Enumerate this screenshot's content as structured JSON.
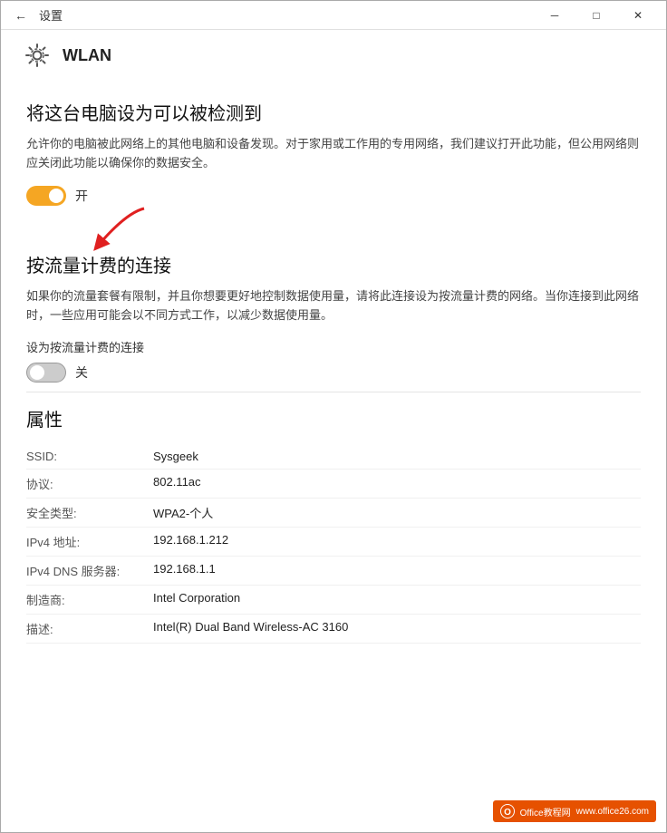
{
  "titlebar": {
    "back_label": "←",
    "title": "设置",
    "minimize_label": "─",
    "maximize_label": "□",
    "close_label": "✕"
  },
  "page_header": {
    "icon": "⚙",
    "title": "WLAN"
  },
  "section1": {
    "title": "将这台电脑设为可以被检测到",
    "desc": "允许你的电脑被此网络上的其他电脑和设备发现。对于家用或工作用的专用网络，我们建议打开此功能，但公用网络则应关闭此功能以确保你的数据安全。",
    "toggle_state": "on",
    "toggle_label": "开"
  },
  "section2": {
    "title": "按流量计费的连接",
    "desc": "如果你的流量套餐有限制，并且你想要更好地控制数据使用量，请将此连接设为按流量计费的网络。当你连接到此网络时，一些应用可能会以不同方式工作，以减少数据使用量。",
    "metered_label": "设为按流量计费的连接",
    "toggle_state": "off",
    "toggle_label": "关"
  },
  "properties": {
    "title": "属性",
    "rows": [
      {
        "label": "SSID:",
        "value": "Sysgeek"
      },
      {
        "label": "协议:",
        "value": "802.11ac"
      },
      {
        "label": "安全类型:",
        "value": "WPA2-个人"
      },
      {
        "label": "IPv4 地址:",
        "value": "192.168.1.212"
      },
      {
        "label": "IPv4 DNS 服务器:",
        "value": "192.168.1.1"
      },
      {
        "label": "制造商:",
        "value": "Intel Corporation"
      },
      {
        "label": "描述:",
        "value": "Intel(R) Dual Band Wireless-AC 3160"
      }
    ]
  },
  "watermark": {
    "icon": "O",
    "text": "Office教程网",
    "subtext": "www.office26.com"
  }
}
